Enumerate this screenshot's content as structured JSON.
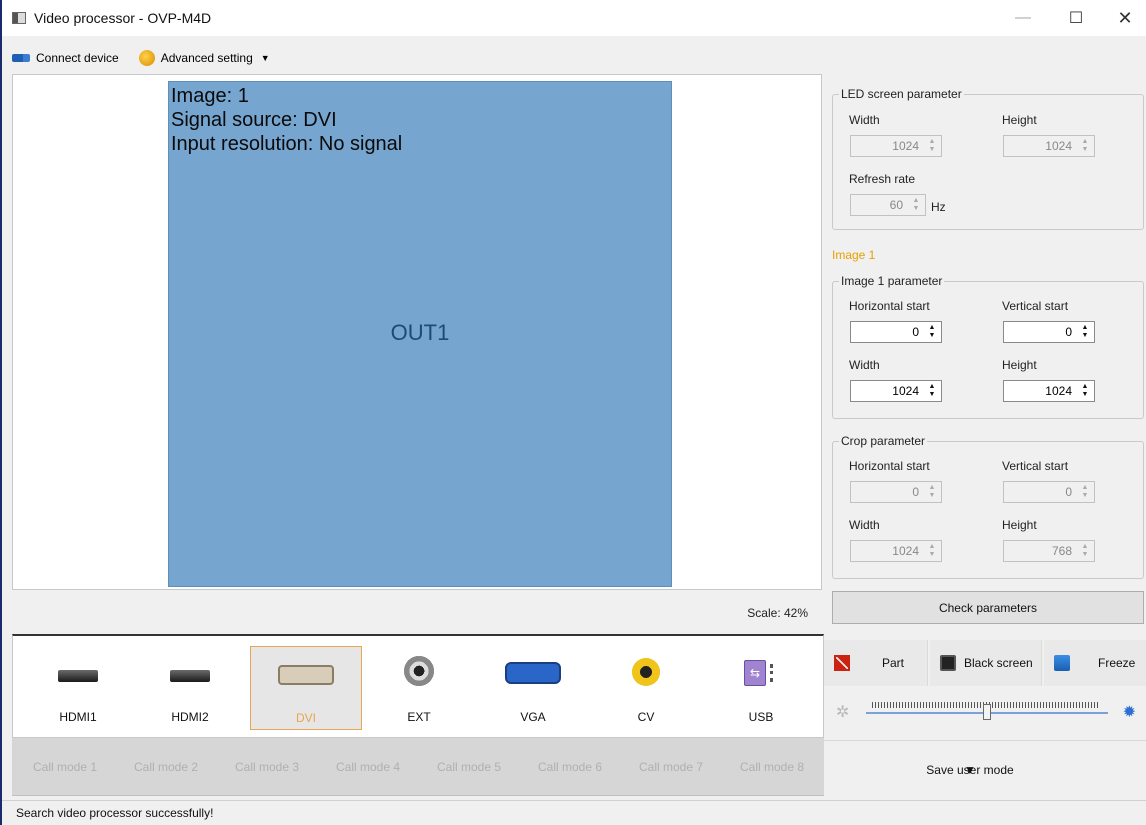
{
  "window": {
    "title": "Video processor  -  OVP-M4D"
  },
  "toolbar": {
    "connect_label": "Connect device",
    "advanced_label": "Advanced setting"
  },
  "canvas": {
    "image_label": "Image: 1",
    "signal_source": "Signal source: DVI",
    "input_resolution": "Input resolution: No signal",
    "output_label": "OUT1",
    "scale": "Scale: 42%"
  },
  "led": {
    "title": "LED screen parameter",
    "width_label": "Width",
    "width_value": "1024",
    "height_label": "Height",
    "height_value": "1024",
    "refresh_label": "Refresh rate",
    "refresh_value": "60",
    "refresh_unit": "Hz"
  },
  "image_section_label": "Image 1",
  "image1": {
    "title": "Image 1 parameter",
    "hstart_label": "Horizontal start",
    "hstart_value": "0",
    "vstart_label": "Vertical start",
    "vstart_value": "0",
    "width_label": "Width",
    "width_value": "1024",
    "height_label": "Height",
    "height_value": "1024"
  },
  "crop": {
    "title": "Crop parameter",
    "hstart_label": "Horizontal start",
    "hstart_value": "0",
    "vstart_label": "Vertical start",
    "vstart_value": "0",
    "width_label": "Width",
    "width_value": "1024",
    "height_label": "Height",
    "height_value": "768"
  },
  "check_button": "Check parameters",
  "sources": [
    {
      "label": "HDMI1",
      "icon": "hdmi-port-icon",
      "selected": false
    },
    {
      "label": "HDMI2",
      "icon": "hdmi-port-icon",
      "selected": false
    },
    {
      "label": "DVI",
      "icon": "dvi-port-icon",
      "selected": true
    },
    {
      "label": "EXT",
      "icon": "bnc-port-icon",
      "selected": false
    },
    {
      "label": "VGA",
      "icon": "vga-port-icon",
      "selected": false
    },
    {
      "label": "CV",
      "icon": "rca-port-icon",
      "selected": false
    },
    {
      "label": "USB",
      "icon": "usb-port-icon",
      "selected": false
    }
  ],
  "call_modes": [
    "Call mode 1",
    "Call mode 2",
    "Call mode 3",
    "Call mode 4",
    "Call mode 5",
    "Call mode 6",
    "Call mode 7",
    "Call mode 8"
  ],
  "controls": {
    "part": "Part",
    "black_screen": "Black screen",
    "freeze": "Freeze",
    "brightness_level": 0.5
  },
  "save_mode": "Save user mode",
  "status": "Search video processor successfully!",
  "colors": {
    "output_fill": "#76a6d0",
    "accent": "#e8a000",
    "selected_border": "#e8a552"
  }
}
